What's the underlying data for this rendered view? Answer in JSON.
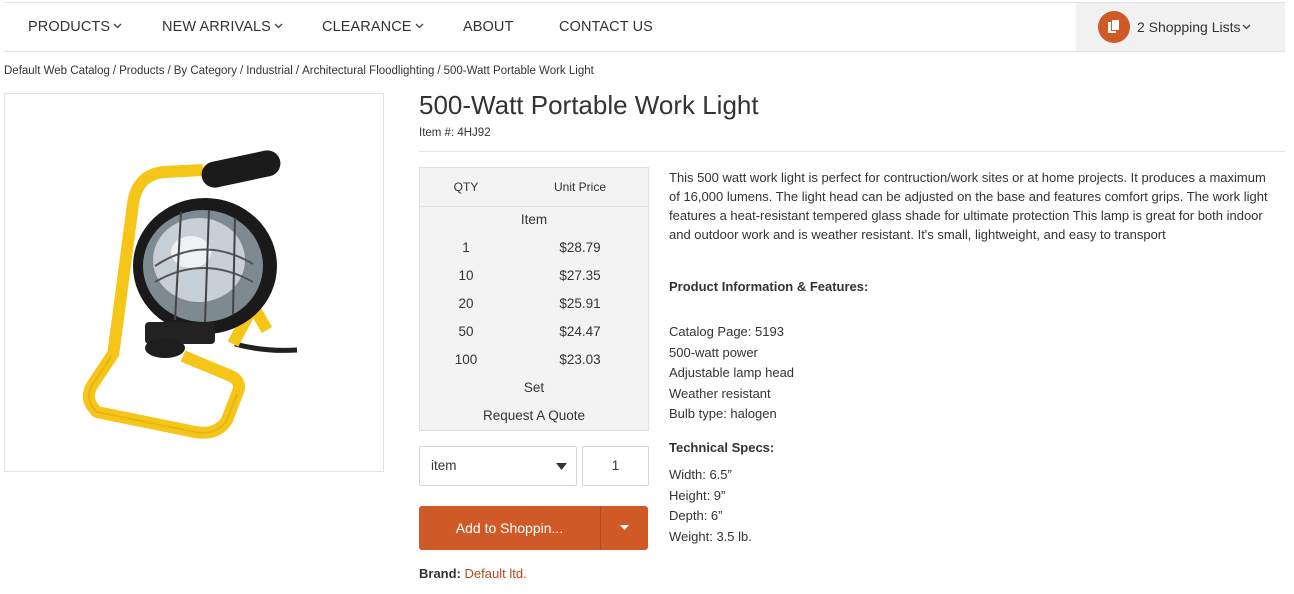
{
  "nav": {
    "items": [
      {
        "label": "PRODUCTS",
        "dropdown": true
      },
      {
        "label": "NEW ARRIVALS",
        "dropdown": true
      },
      {
        "label": "CLEARANCE",
        "dropdown": true
      },
      {
        "label": "ABOUT",
        "dropdown": false
      },
      {
        "label": "CONTACT US",
        "dropdown": false
      }
    ],
    "shopping_lists": "2 Shopping Lists"
  },
  "breadcrumb": [
    "Default Web Catalog",
    "Products",
    "By Category",
    "Industrial",
    "Architectural Floodlighting",
    "500-Watt Portable Work Light"
  ],
  "product": {
    "title": "500-Watt Portable Work Light",
    "item_number": "Item #: 4HJ92",
    "description": "This 500 watt work light is perfect for contruction/work sites or at home projects. It produces a maximum of 16,000 lumens. The light head can be adjusted on the base and features comfort grips. The work light features a heat-resistant tempered glass shade for ultimate protection This lamp is great for both indoor and outdoor work and is weather resistant. It's small, lightweight, and easy to transport",
    "features_heading": "Product Information & Features:",
    "features": [
      "Catalog Page: 5193",
      "500-watt power",
      "Adjustable lamp head",
      "Weather resistant",
      "Bulb type: halogen"
    ],
    "specs_heading": "Technical Specs:",
    "specs": [
      "Width: 6.5”",
      "Height: 9”",
      "Depth: 6”",
      "Weight: 3.5 lb."
    ],
    "brand_label": "Brand:",
    "brand_value": "Default ltd."
  },
  "pricing": {
    "col_qty": "QTY",
    "col_price": "Unit Price",
    "group_item": "Item",
    "rows": [
      {
        "qty": "1",
        "price": "$28.79"
      },
      {
        "qty": "10",
        "price": "$27.35"
      },
      {
        "qty": "20",
        "price": "$25.91"
      },
      {
        "qty": "50",
        "price": "$24.47"
      },
      {
        "qty": "100",
        "price": "$23.03"
      }
    ],
    "group_set": "Set",
    "request_quote": "Request A Quote"
  },
  "purchase": {
    "unit_selected": "item",
    "quantity": "1",
    "add_button": "Add to Shoppin..."
  },
  "colors": {
    "accent": "#cf5a27",
    "brand_link": "#b4461a",
    "lamp_frame": "#f5c518"
  }
}
